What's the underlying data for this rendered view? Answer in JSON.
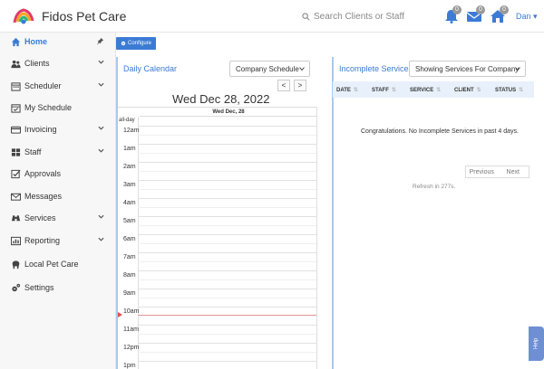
{
  "app": {
    "brand": "Fidos Pet Care"
  },
  "header": {
    "search_placeholder": "Search Clients or Staff",
    "notifications": {
      "icon": "bell-icon",
      "count": "0"
    },
    "messages": {
      "icon": "envelope-icon",
      "count": "0"
    },
    "home": {
      "icon": "house-icon",
      "count": "0"
    },
    "user": "Dan"
  },
  "sidebar": {
    "items": [
      {
        "label": "Home",
        "icon": "home-icon",
        "active": true
      },
      {
        "label": "Clients",
        "icon": "users-icon"
      },
      {
        "label": "Scheduler",
        "icon": "calendar-icon"
      },
      {
        "label": "My Schedule",
        "icon": "calendar-check-icon"
      },
      {
        "label": "Invoicing",
        "icon": "credit-card-icon"
      },
      {
        "label": "Staff",
        "icon": "grid-icon"
      },
      {
        "label": "Approvals",
        "icon": "checkbox-icon"
      },
      {
        "label": "Messages",
        "icon": "envelope-icon"
      },
      {
        "label": "Services",
        "icon": "binoculars-icon"
      },
      {
        "label": "Reporting",
        "icon": "chart-icon"
      },
      {
        "label": "Local Pet Care",
        "icon": "paw-icon"
      },
      {
        "label": "Settings",
        "icon": "cogs-icon"
      }
    ]
  },
  "toolbar": {
    "configure_label": "Configure"
  },
  "calendar": {
    "title": "Daily Calendar",
    "select_value": "Company Schedule",
    "prev_label": "<",
    "next_label": ">",
    "date_heading": "Wed Dec 28, 2022",
    "day_column": "Wed Dec, 28",
    "allday_label": "all-day",
    "hours": [
      "12am",
      "1am",
      "2am",
      "3am",
      "4am",
      "5am",
      "6am",
      "7am",
      "8am",
      "9am",
      "10am",
      "11am",
      "12pm",
      "1pm"
    ]
  },
  "services": {
    "title": "Incomplete Services",
    "select_value": "Showing Services For Company",
    "columns": [
      "DATE",
      "STAFF",
      "SERVICE",
      "CLIENT",
      "STATUS"
    ],
    "empty_message": "Congratulations. No Incomplete Services in past 4 days.",
    "pager": {
      "previous": "Previous",
      "next": "Next"
    },
    "refresh_text": "Refresh in 277s."
  },
  "help": {
    "label": "Help"
  },
  "colors": {
    "accent": "#3b7bd4",
    "panel_border": "#a9c9ee",
    "now_line": "#e89a9a"
  }
}
